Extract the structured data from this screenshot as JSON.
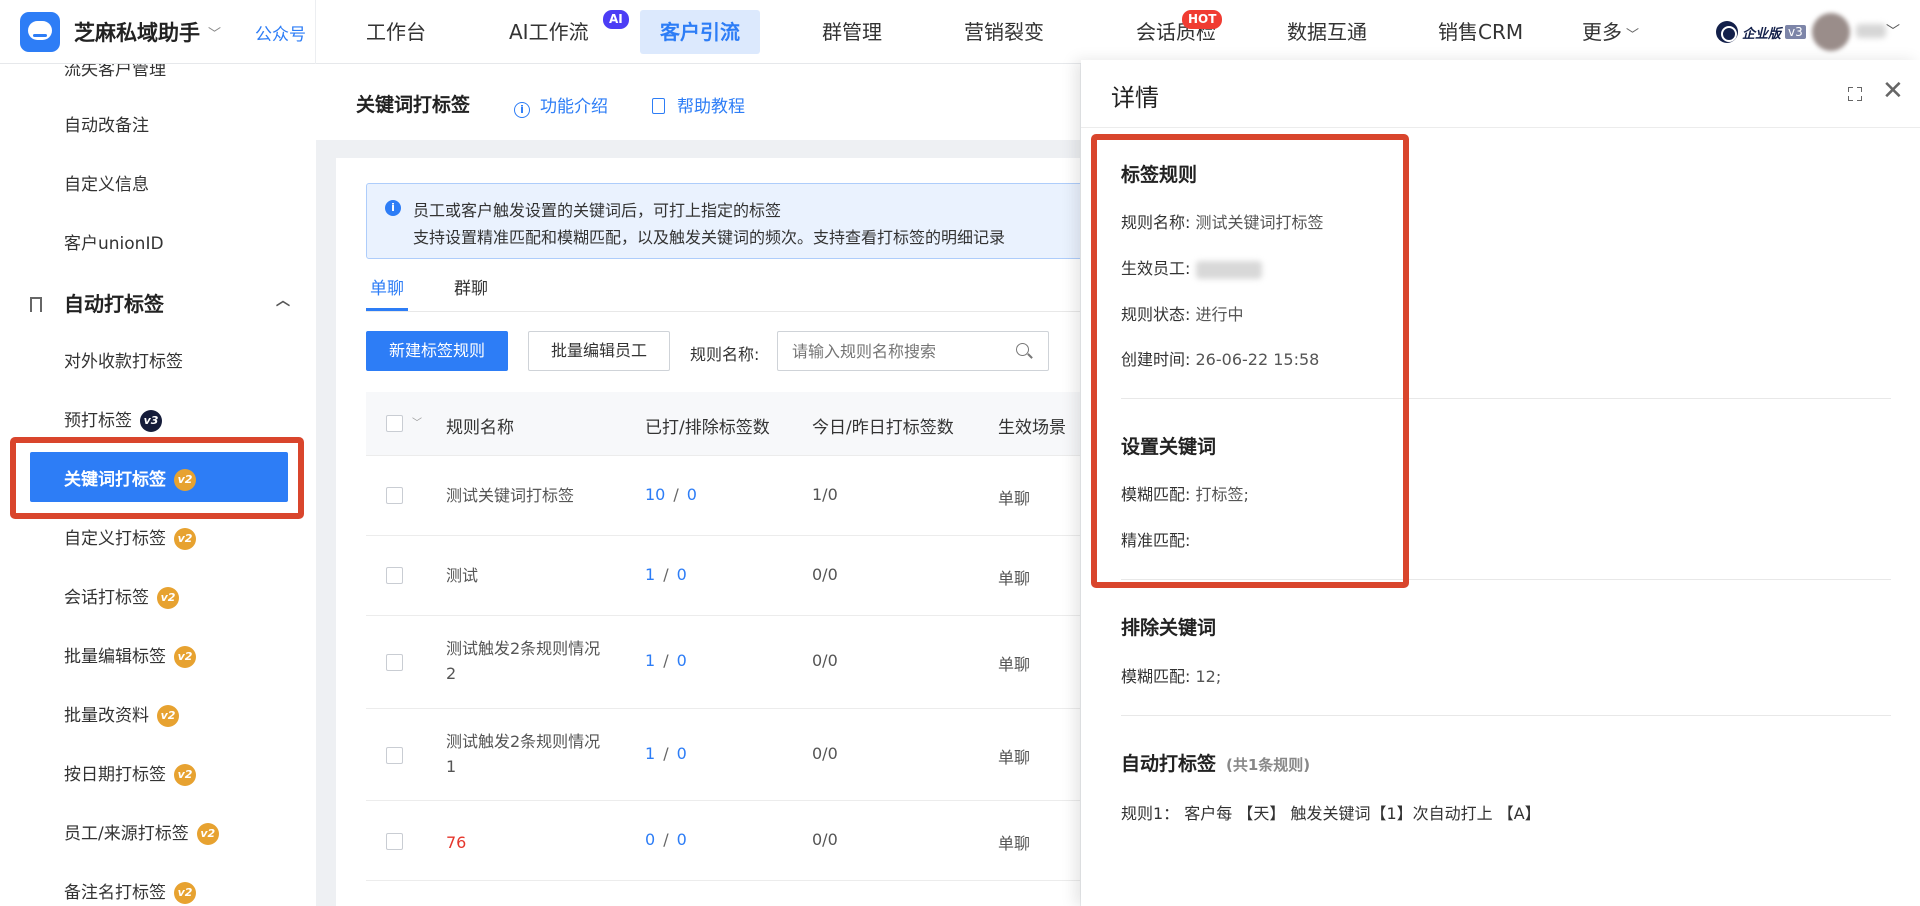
{
  "app": {
    "name": "芝麻私域助手",
    "account_link": "公众号"
  },
  "nav": [
    {
      "label": "工作台",
      "badge": ""
    },
    {
      "label": "AI工作流",
      "badge": "AI"
    },
    {
      "label": "客户引流",
      "badge": ""
    },
    {
      "label": "群管理",
      "badge": ""
    },
    {
      "label": "营销裂变",
      "badge": ""
    },
    {
      "label": "会话质检",
      "badge": "HOT"
    },
    {
      "label": "数据互通",
      "badge": ""
    },
    {
      "label": "销售CRM",
      "badge": ""
    },
    {
      "label": "更多",
      "badge": ""
    }
  ],
  "nav_active": "客户引流",
  "edition": {
    "label": "企业版",
    "version": "v3"
  },
  "sidebar": {
    "items_above": [
      "流失客户管理",
      "自动改备注",
      "自定义信息",
      "客户unionID"
    ],
    "group": "自动打标签",
    "items": [
      {
        "label": "对外收款打标签",
        "badge": ""
      },
      {
        "label": "预打标签",
        "badge": "v3"
      },
      {
        "label": "关键词打标签",
        "badge": "v2",
        "active": true
      },
      {
        "label": "自定义打标签",
        "badge": "v2"
      },
      {
        "label": "会话打标签",
        "badge": "v2"
      },
      {
        "label": "批量编辑标签",
        "badge": "v2"
      },
      {
        "label": "批量改资料",
        "badge": "v2"
      },
      {
        "label": "按日期打标签",
        "badge": "v2"
      },
      {
        "label": "员工/来源打标签",
        "badge": "v2"
      },
      {
        "label": "备注名打标签",
        "badge": "v2"
      }
    ]
  },
  "page": {
    "title": "关键词打标签",
    "intro_link": "功能介绍",
    "help_link": "帮助教程",
    "tip_line1": "员工或客户触发设置的关键词后，可打上指定的标签",
    "tip_line2": "支持设置精准匹配和模糊匹配，以及触发关键词的频次。支持查看打标签的明细记录",
    "tabs": [
      "单聊",
      "群聊"
    ],
    "new_button": "新建标签规则",
    "batch_button": "批量编辑员工",
    "filter_label": "规则名称:",
    "search_placeholder": "请输入规则名称搜索"
  },
  "table": {
    "columns": [
      "规则名称",
      "已打/排除标签数",
      "今日/昨日打标签数",
      "生效场景"
    ],
    "rows": [
      {
        "name": "测试关键词打标签",
        "tagged": "10",
        "excluded": "0",
        "today_yesterday": "1/0",
        "scene": "单聊"
      },
      {
        "name": "测试",
        "tagged": "1",
        "excluded": "0",
        "today_yesterday": "0/0",
        "scene": "单聊"
      },
      {
        "name": "测试触发2条规则情况2",
        "tagged": "1",
        "excluded": "0",
        "today_yesterday": "0/0",
        "scene": "单聊"
      },
      {
        "name": "测试触发2条规则情况1",
        "tagged": "1",
        "excluded": "0",
        "today_yesterday": "0/0",
        "scene": "单聊"
      },
      {
        "name": "76",
        "tagged": "0",
        "excluded": "0",
        "today_yesterday": "0/0",
        "scene": "单聊",
        "highlight": "#e5352b"
      }
    ]
  },
  "drawer": {
    "title": "详情",
    "tag_rule": {
      "title": "标签规则",
      "name_label": "规则名称:",
      "name_value": "测试关键词打标签",
      "staff_label": "生效员工:",
      "status_label": "规则状态:",
      "status_value": "进行中",
      "created_label": "创建时间:",
      "created_value": "26-06-22 15:58"
    },
    "keywords": {
      "title": "设置关键词",
      "fuzzy_label": "模糊匹配:",
      "fuzzy_value": "打标签;",
      "exact_label": "精准匹配:",
      "exact_value": ""
    },
    "exclude": {
      "title": "排除关键词",
      "fuzzy_label": "模糊匹配:",
      "fuzzy_value": "12;"
    },
    "auto": {
      "title": "自动打标签",
      "subtitle": "(共1条规则)",
      "rule1": "规则1： 客户每 【天】 触发关键词【1】次自动打上 【A】"
    }
  },
  "colors": {
    "primary": "#2d7df6",
    "annotation": "#d9452c",
    "badge_v2": "#e7a230",
    "badge_v3": "#151c3a",
    "hot": "#f03c32",
    "ai": "#4c3df5"
  }
}
